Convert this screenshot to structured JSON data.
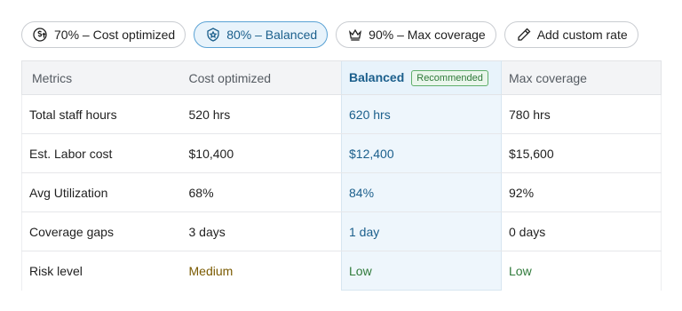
{
  "chips": [
    {
      "label": "70% – Cost optimized",
      "icon": "dollar-trend-icon",
      "selected": false
    },
    {
      "label": "80% – Balanced",
      "icon": "shield-star-icon",
      "selected": true
    },
    {
      "label": "90% – Max coverage",
      "icon": "crown-icon",
      "selected": false
    },
    {
      "label": "Add custom rate",
      "icon": "pencil-icon",
      "selected": false
    }
  ],
  "table": {
    "headers": {
      "metrics": "Metrics",
      "cost": "Cost optimized",
      "balanced": "Balanced",
      "balanced_badge": "Recommended",
      "max": "Max coverage"
    },
    "rows": [
      {
        "metric": "Total staff hours",
        "cost": "520 hrs",
        "balanced": "620 hrs",
        "max": "780 hrs"
      },
      {
        "metric": "Est. Labor cost",
        "cost": "$10,400",
        "balanced": "$12,400",
        "max": "$15,600"
      },
      {
        "metric": "Avg Utilization",
        "cost": "68%",
        "balanced": "84%",
        "max": "92%"
      },
      {
        "metric": "Coverage gaps",
        "cost": "3 days",
        "balanced": "1 day",
        "max": "0 days"
      },
      {
        "metric": "Risk level",
        "cost": "Medium",
        "balanced": "Low",
        "max": "Low"
      }
    ]
  },
  "colors": {
    "accent": "#1b5f8c",
    "selected_bg": "#e8f3fb",
    "risk_medium": "#7a5a00",
    "risk_low": "#2f7a3a"
  }
}
